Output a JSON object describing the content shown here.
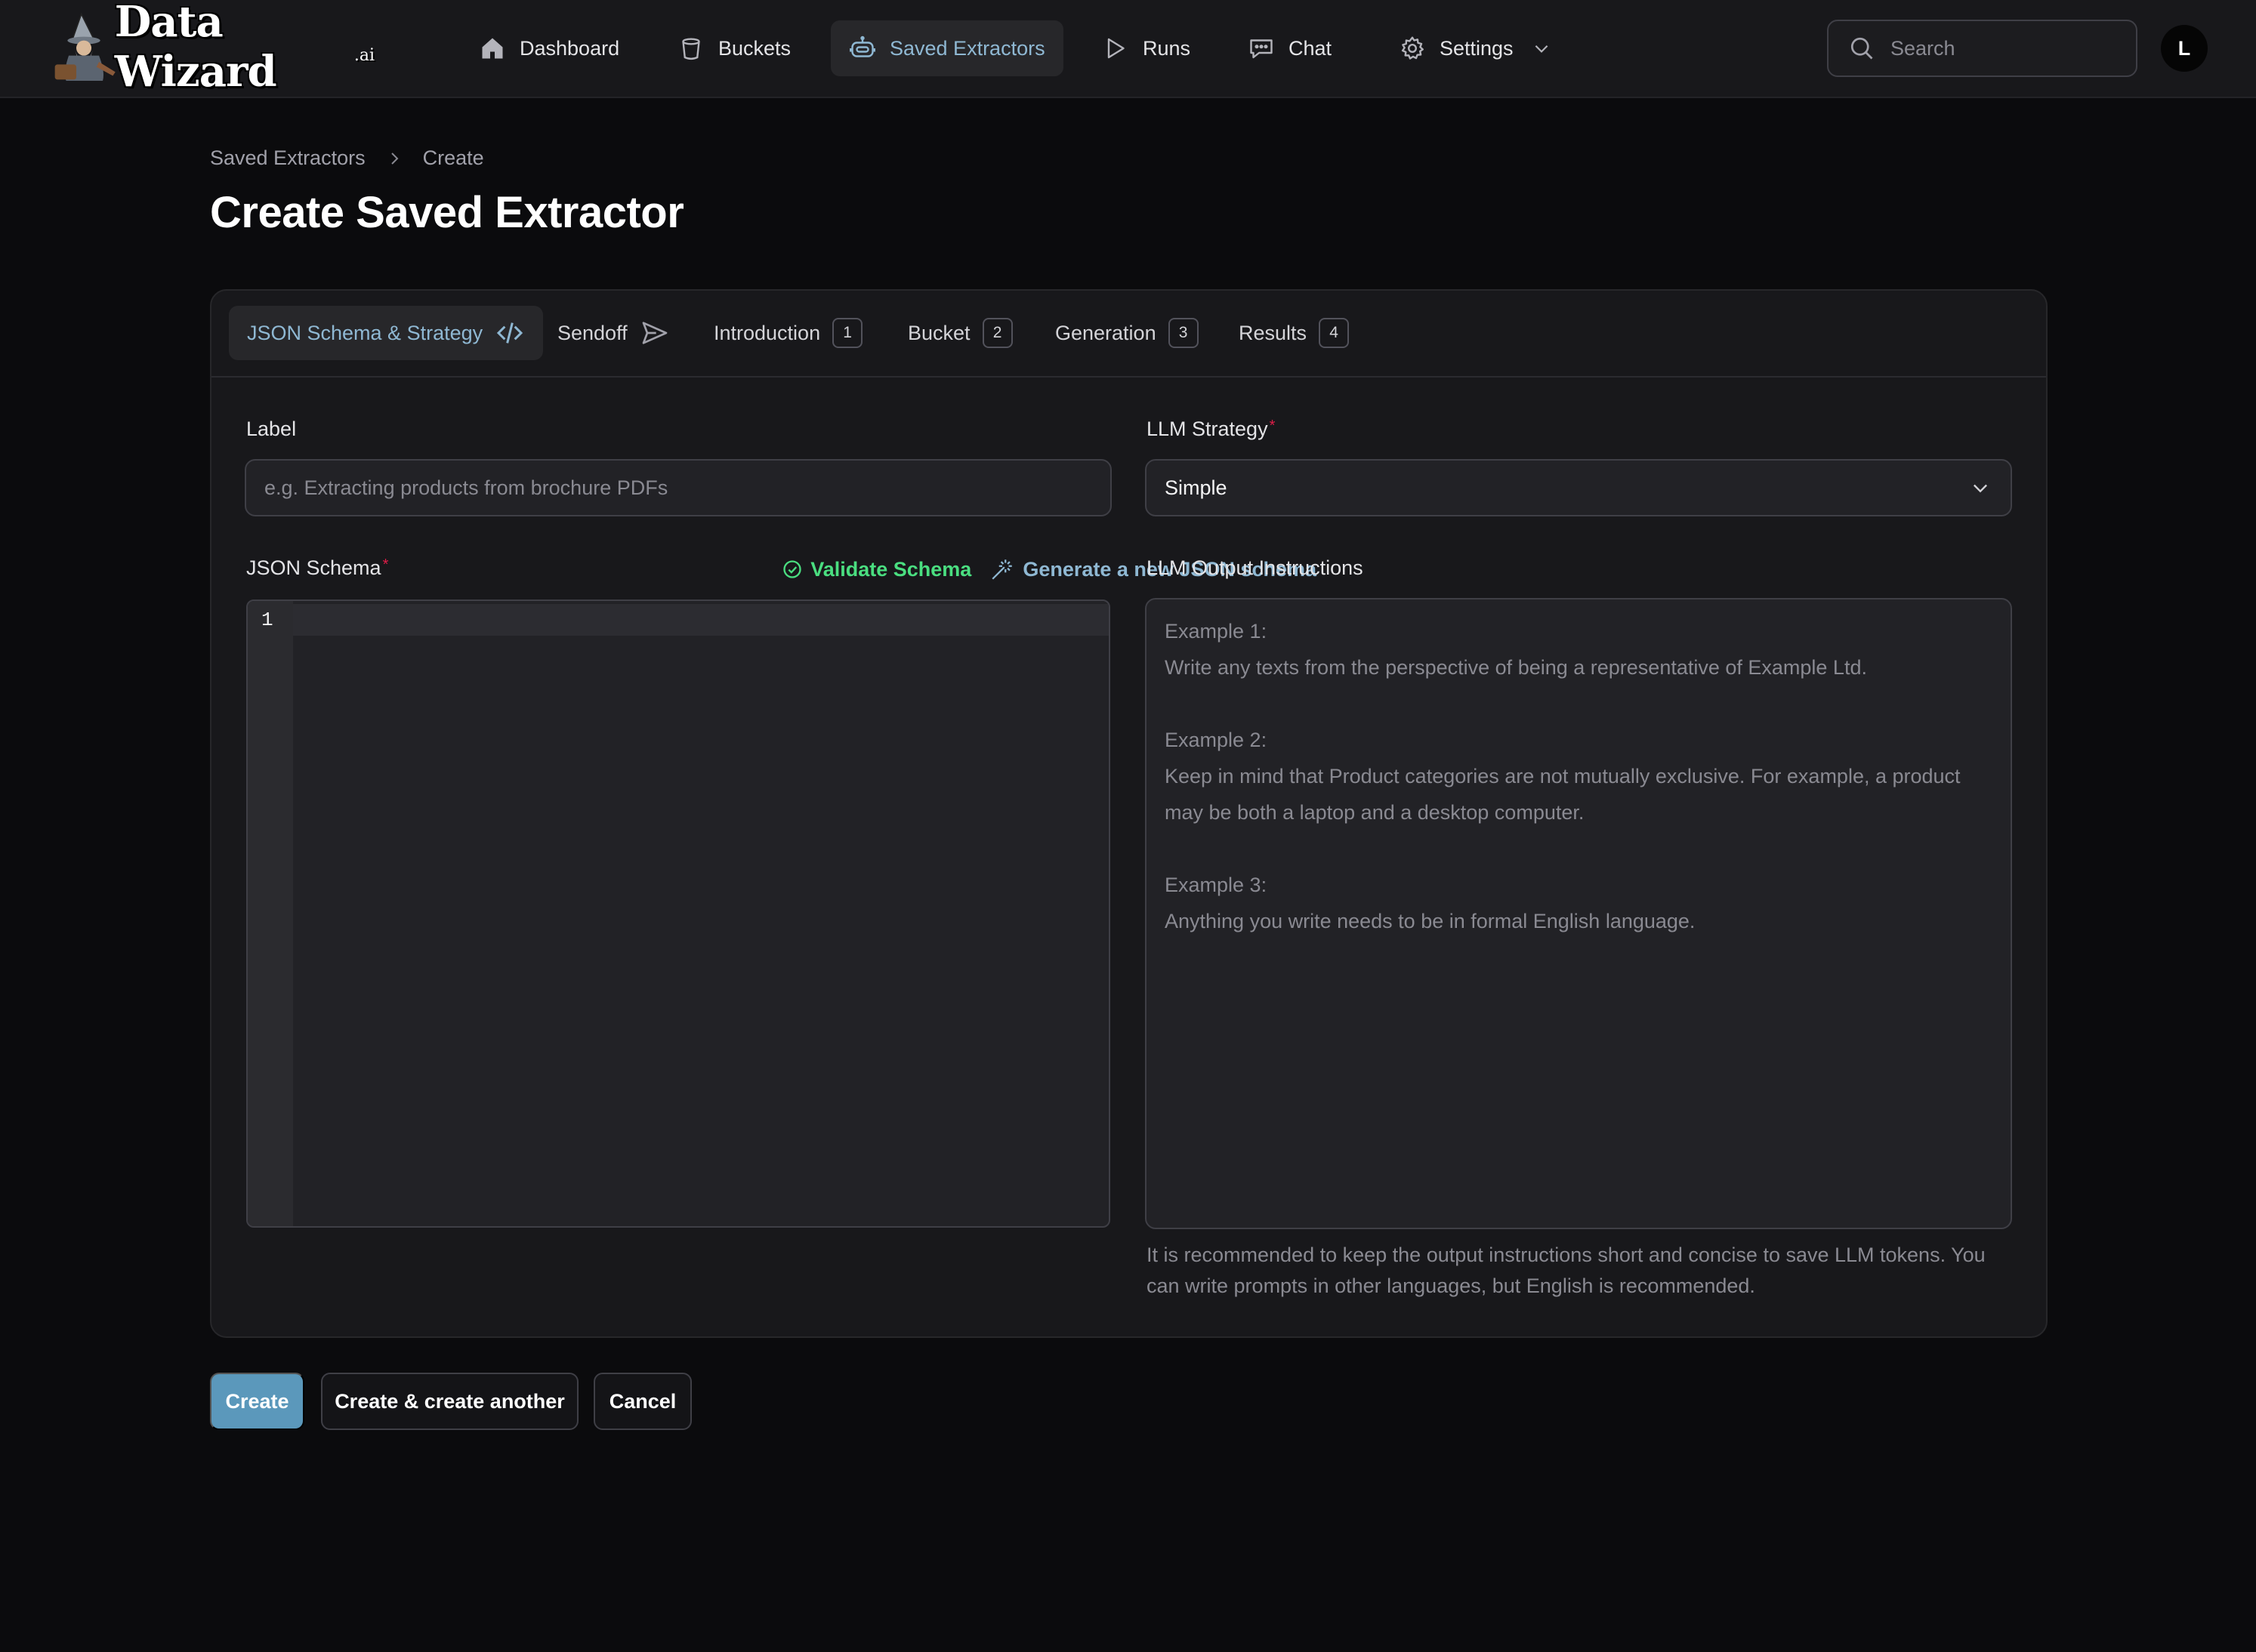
{
  "brand": {
    "name": "Data Wizard",
    "suffix": ".ai"
  },
  "nav": {
    "items": [
      {
        "label": "Dashboard",
        "icon": "home-icon"
      },
      {
        "label": "Buckets",
        "icon": "bucket-icon"
      },
      {
        "label": "Saved Extractors",
        "icon": "robot-icon",
        "active": true
      },
      {
        "label": "Runs",
        "icon": "play-icon"
      },
      {
        "label": "Chat",
        "icon": "chat-icon"
      },
      {
        "label": "Settings",
        "icon": "gear-icon"
      }
    ]
  },
  "search": {
    "placeholder": "Search"
  },
  "user": {
    "initial": "L"
  },
  "breadcrumb": {
    "parent": "Saved Extractors",
    "current": "Create"
  },
  "page": {
    "title": "Create Saved Extractor"
  },
  "tabs": [
    {
      "label": "JSON Schema & Strategy",
      "icon": "code-icon",
      "active": true
    },
    {
      "label": "Sendoff",
      "icon": "send-icon"
    },
    {
      "label": "Introduction",
      "badge": "1"
    },
    {
      "label": "Bucket",
      "badge": "2"
    },
    {
      "label": "Generation",
      "badge": "3"
    },
    {
      "label": "Results",
      "badge": "4"
    }
  ],
  "form": {
    "label_field": {
      "label": "Label",
      "placeholder": "e.g. Extracting products from brochure PDFs",
      "value": ""
    },
    "strategy_field": {
      "label": "LLM Strategy",
      "required": "*",
      "value": "Simple"
    },
    "schema_field": {
      "label": "JSON Schema",
      "required": "*",
      "validate_label": "Validate Schema",
      "generate_label": "Generate a new JSON schema",
      "line_number": "1"
    },
    "instructions_field": {
      "label": "LLM Output Instructions",
      "placeholder": "Example 1:\nWrite any texts from the perspective of being a representative of Example Ltd.\n\nExample 2:\nKeep in mind that Product categories are not mutually exclusive. For example, a product\nmay be both a laptop and a desktop computer.\n\nExample 3:\nAnything you write needs to be in formal English language.",
      "hint": "It is recommended to keep the output instructions short and concise to save LLM tokens. You can write prompts in other languages, but English is recommended."
    }
  },
  "actions": {
    "create": "Create",
    "create_another": "Create & create another",
    "cancel": "Cancel"
  },
  "colors": {
    "accent": "#8fb8d3",
    "primary_button": "#5b98bb",
    "success": "#4ade80",
    "required": "#e11d48",
    "background": "#0b0b0d",
    "card": "#18181b"
  }
}
